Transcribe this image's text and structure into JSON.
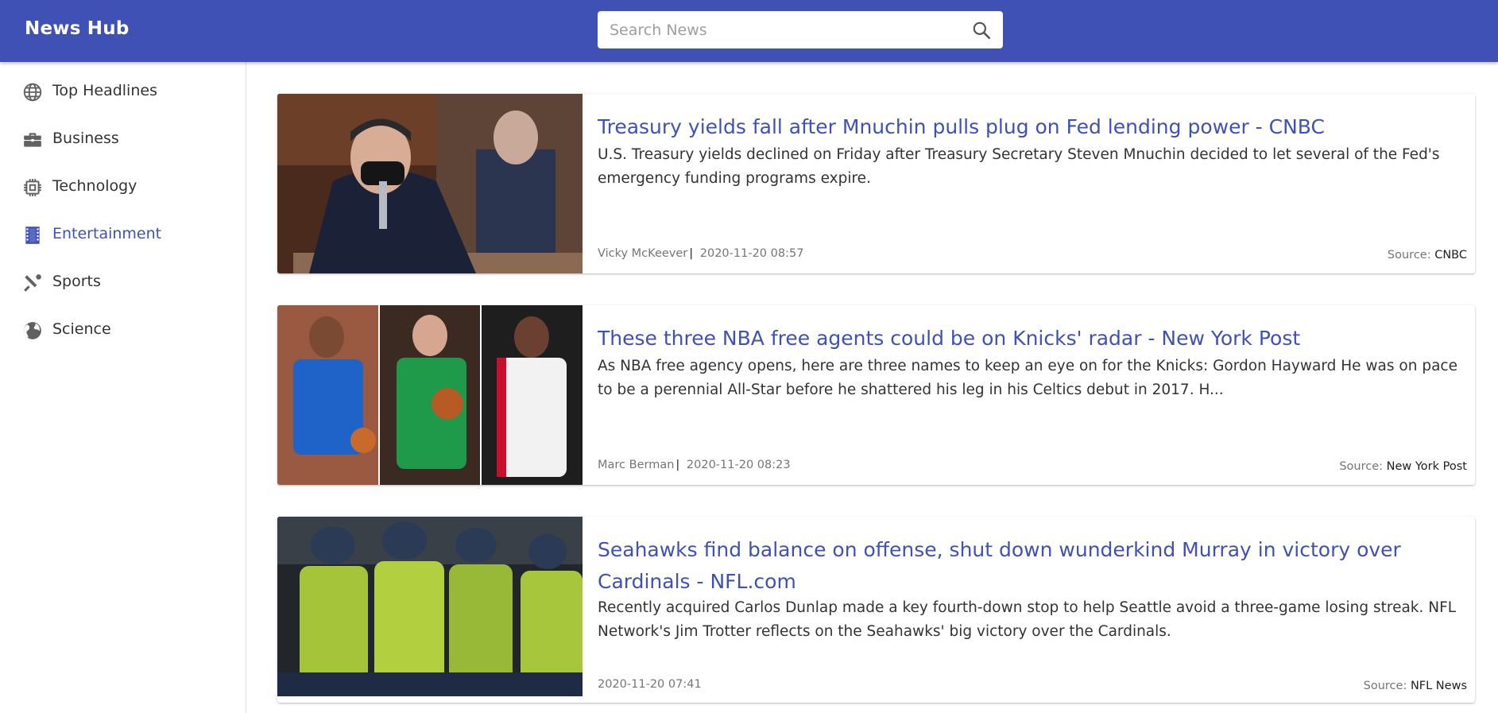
{
  "header": {
    "brand": "News Hub",
    "search_placeholder": "Search News",
    "accent_color": "#3f51b5"
  },
  "sidebar": {
    "items": [
      {
        "label": "Top Headlines",
        "icon": "globe-icon",
        "active": false
      },
      {
        "label": "Business",
        "icon": "briefcase-icon",
        "active": false
      },
      {
        "label": "Technology",
        "icon": "chip-icon",
        "active": false
      },
      {
        "label": "Entertainment",
        "icon": "film-icon",
        "active": true
      },
      {
        "label": "Sports",
        "icon": "sports-icon",
        "active": false
      },
      {
        "label": "Science",
        "icon": "earth-icon",
        "active": false
      }
    ]
  },
  "articles": [
    {
      "title": "Treasury yields fall after Mnuchin pulls plug on Fed lending power - CNBC",
      "description": "U.S. Treasury yields declined on Friday after Treasury Secretary Steven Mnuchin decided to let several of the Fed's emergency funding programs expire.",
      "author": "Vicky McKeever",
      "separator": "|",
      "date": "2020-11-20 08:57",
      "source_label": "Source:",
      "source": "CNBC"
    },
    {
      "title": "These three NBA free agents could be on Knicks' radar - New York Post",
      "description": "As NBA free agency opens, here are three names to keep an eye on for the Knicks: Gordon Hayward He was on pace to be a perennial All-Star before he shattered his leg in his Celtics debut in 2017. H...",
      "author": "Marc Berman",
      "separator": "|",
      "date": "2020-11-20 08:23",
      "source_label": "Source:",
      "source": "New York Post"
    },
    {
      "title": "Seahawks find balance on offense, shut down wunderkind Murray in victory over Cardinals - NFL.com",
      "description": "Recently acquired Carlos Dunlap made a key fourth-down stop to help Seattle avoid a three-game losing streak. NFL Network's Jim Trotter reflects on the Seahawks' big victory over the Cardinals.",
      "date": "2020-11-20 07:41",
      "source_label": "Source:",
      "source": "NFL News"
    }
  ]
}
